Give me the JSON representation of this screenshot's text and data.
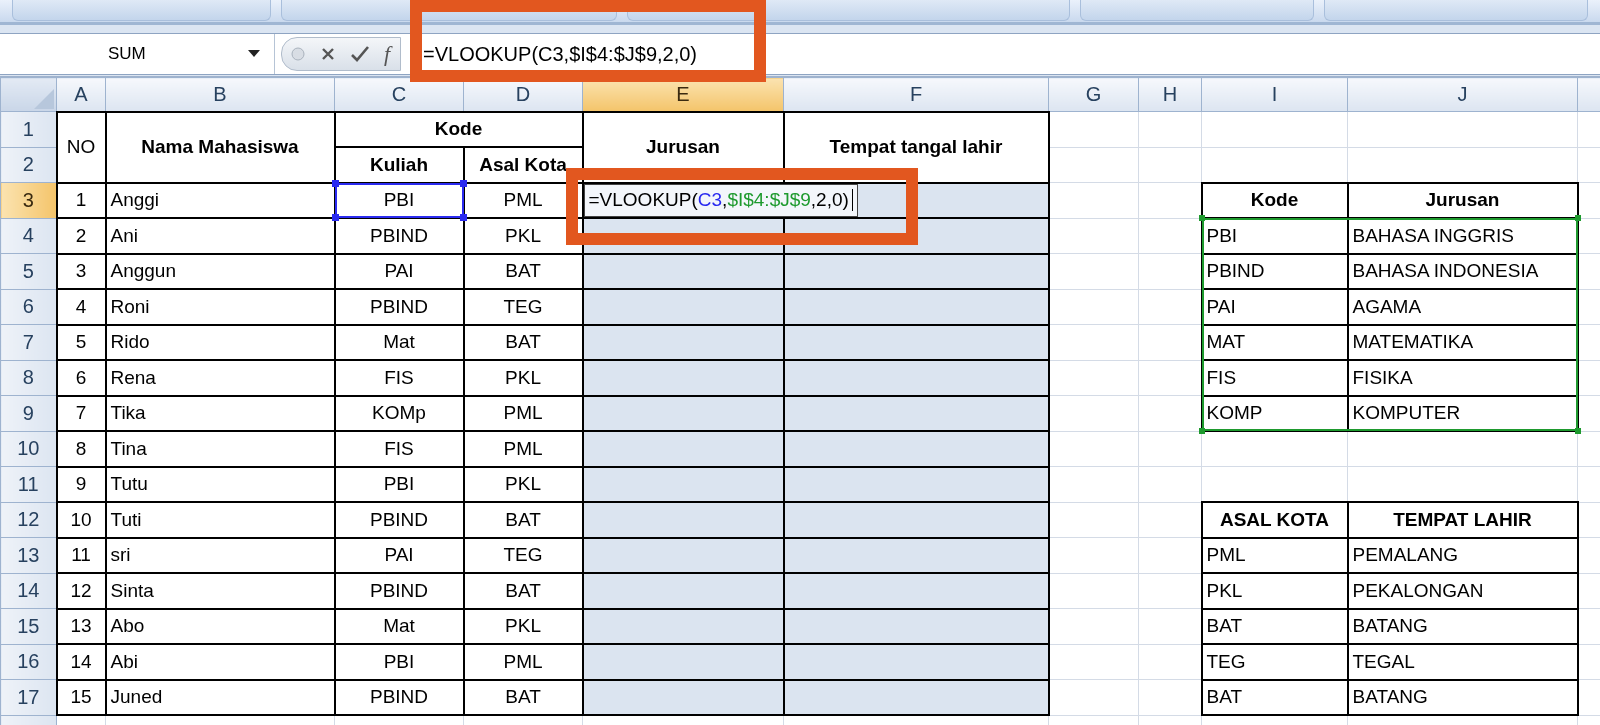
{
  "formula_bar": {
    "name_box": "SUM",
    "function_label": "f",
    "formula": "=VLOOKUP(C3,$I$4:$J$9,2,0)"
  },
  "columns": [
    {
      "label": "A",
      "selected": false
    },
    {
      "label": "B",
      "selected": false
    },
    {
      "label": "C",
      "selected": false
    },
    {
      "label": "D",
      "selected": false
    },
    {
      "label": "E",
      "selected": true
    },
    {
      "label": "F",
      "selected": false
    },
    {
      "label": "G",
      "selected": false
    },
    {
      "label": "H",
      "selected": false
    },
    {
      "label": "I",
      "selected": false
    },
    {
      "label": "J",
      "selected": false
    }
  ],
  "row_headers": [
    {
      "label": "1",
      "selected": false
    },
    {
      "label": "2",
      "selected": false
    },
    {
      "label": "3",
      "selected": true
    },
    {
      "label": "4",
      "selected": false
    },
    {
      "label": "5",
      "selected": false
    },
    {
      "label": "6",
      "selected": false
    },
    {
      "label": "7",
      "selected": false
    },
    {
      "label": "8",
      "selected": false
    },
    {
      "label": "9",
      "selected": false
    },
    {
      "label": "10",
      "selected": false
    },
    {
      "label": "11",
      "selected": false
    },
    {
      "label": "12",
      "selected": false
    },
    {
      "label": "13",
      "selected": false
    },
    {
      "label": "14",
      "selected": false
    },
    {
      "label": "15",
      "selected": false
    },
    {
      "label": "16",
      "selected": false
    },
    {
      "label": "17",
      "selected": false
    }
  ],
  "main_table": {
    "headers": {
      "no": "NO",
      "nama": "Nama Mahasiswa",
      "kode": "Kode",
      "kuliah": "Kuliah",
      "asal_kota": "Asal Kota",
      "jurusan": "Jurusan",
      "tempat": "Tempat tangal lahir"
    },
    "rows": [
      {
        "no": "1",
        "nama": "Anggi",
        "kuliah": "PBI",
        "asal_kota": "PML"
      },
      {
        "no": "2",
        "nama": "Ani",
        "kuliah": "PBIND",
        "asal_kota": "PKL"
      },
      {
        "no": "3",
        "nama": "Anggun",
        "kuliah": "PAI",
        "asal_kota": "BAT"
      },
      {
        "no": "4",
        "nama": "Roni",
        "kuliah": "PBIND",
        "asal_kota": "TEG"
      },
      {
        "no": "5",
        "nama": "Rido",
        "kuliah": "Mat",
        "asal_kota": "BAT"
      },
      {
        "no": "6",
        "nama": "Rena",
        "kuliah": "FIS",
        "asal_kota": "PKL"
      },
      {
        "no": "7",
        "nama": "Tika",
        "kuliah": "KOMp",
        "asal_kota": "PML"
      },
      {
        "no": "8",
        "nama": "Tina",
        "kuliah": "FIS",
        "asal_kota": "PML"
      },
      {
        "no": "9",
        "nama": "Tutu",
        "kuliah": "PBI",
        "asal_kota": "PKL"
      },
      {
        "no": "10",
        "nama": "Tuti",
        "kuliah": "PBIND",
        "asal_kota": "BAT"
      },
      {
        "no": "11",
        "nama": "sri",
        "kuliah": "PAI",
        "asal_kota": "TEG"
      },
      {
        "no": "12",
        "nama": "Sinta",
        "kuliah": "PBIND",
        "asal_kota": "BAT"
      },
      {
        "no": "13",
        "nama": "Abo",
        "kuliah": "Mat",
        "asal_kota": "PKL"
      },
      {
        "no": "14",
        "nama": "Abi",
        "kuliah": "PBI",
        "asal_kota": "PML"
      },
      {
        "no": "15",
        "nama": "Juned",
        "kuliah": "PBIND",
        "asal_kota": "BAT"
      }
    ]
  },
  "cell_editor": {
    "tokens": [
      {
        "text": "=VLOOKUP(",
        "kind": "plain"
      },
      {
        "text": "C3",
        "kind": "cell_ref"
      },
      {
        "text": ",",
        "kind": "plain"
      },
      {
        "text": "$I$4:$J$9",
        "kind": "range_ref"
      },
      {
        "text": ",2,0)",
        "kind": "plain"
      }
    ]
  },
  "lookup_tables": [
    {
      "range_highlighted": true,
      "headers": [
        "Kode",
        "Jurusan"
      ],
      "rows": [
        [
          "PBI",
          "BAHASA INGGRIS"
        ],
        [
          "PBIND",
          "BAHASA INDONESIA"
        ],
        [
          "PAI",
          "AGAMA"
        ],
        [
          "MAT",
          "MATEMATIKA"
        ],
        [
          "FIS",
          "FISIKA"
        ],
        [
          "KOMP",
          "KOMPUTER"
        ]
      ]
    },
    {
      "range_highlighted": false,
      "headers": [
        "ASAL KOTA",
        "TEMPAT LAHIR"
      ],
      "rows": [
        [
          "PML",
          "PEMALANG"
        ],
        [
          "PKL",
          "PEKALONGAN"
        ],
        [
          "BAT",
          "BATANG"
        ],
        [
          "TEG",
          "TEGAL"
        ],
        [
          "BAT",
          "BATANG"
        ]
      ]
    }
  ]
}
